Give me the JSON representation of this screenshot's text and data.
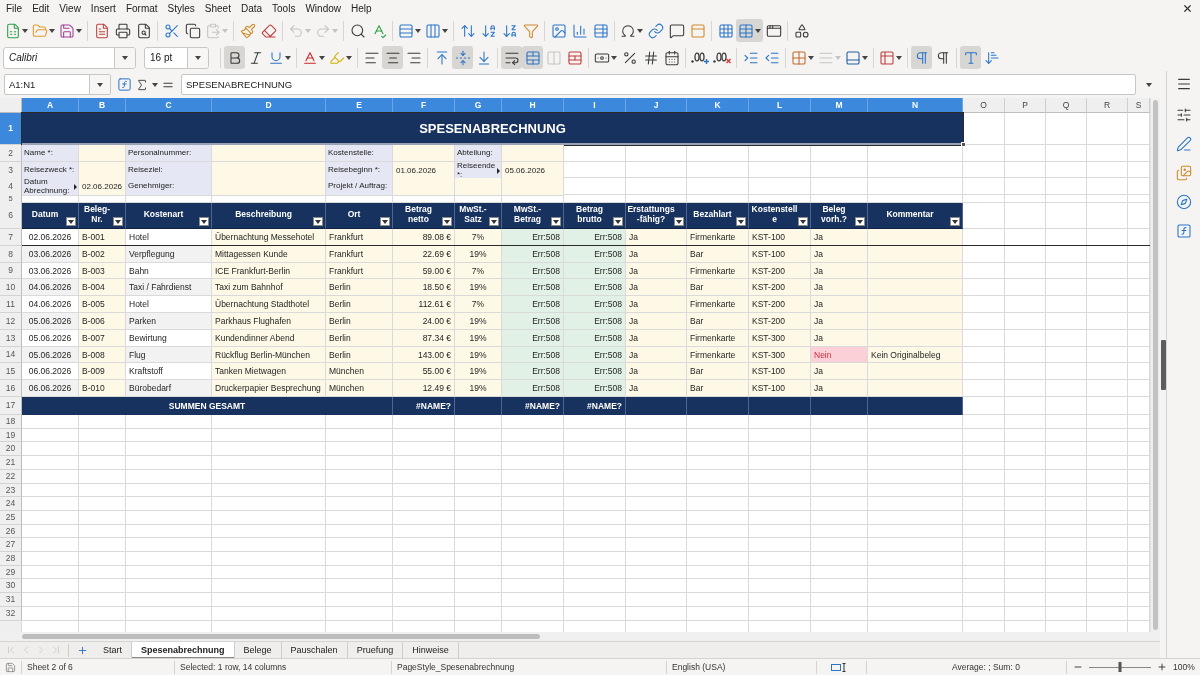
{
  "menu": [
    "File",
    "Edit",
    "View",
    "Insert",
    "Format",
    "Styles",
    "Sheet",
    "Data",
    "Tools",
    "Window",
    "Help"
  ],
  "toolbars": [
    {
      "items": [
        {
          "kind": "button",
          "active": false,
          "disabled": false,
          "dropdown": true
        },
        {
          "kind": "button",
          "active": false,
          "disabled": false,
          "dropdown": true
        },
        {
          "kind": "button",
          "active": false,
          "disabled": false,
          "dropdown": true
        },
        {
          "kind": "separator"
        },
        {
          "kind": "button",
          "active": false,
          "disabled": false,
          "dropdown": false
        },
        {
          "kind": "button",
          "active": false,
          "disabled": false,
          "dropdown": false
        },
        {
          "kind": "button",
          "active": false,
          "disabled": false,
          "dropdown": false
        },
        {
          "kind": "separator"
        },
        {
          "kind": "button",
          "active": false,
          "disabled": false,
          "dropdown": false
        },
        {
          "kind": "button",
          "active": false,
          "disabled": false,
          "dropdown": false
        },
        {
          "kind": "button",
          "active": false,
          "disabled": true,
          "dropdown": true
        },
        {
          "kind": "separator"
        },
        {
          "kind": "button",
          "active": false,
          "disabled": false,
          "dropdown": false
        },
        {
          "kind": "button",
          "active": false,
          "disabled": false,
          "dropdown": false
        },
        {
          "kind": "separator"
        },
        {
          "kind": "button",
          "active": false,
          "disabled": true,
          "dropdown": true
        },
        {
          "kind": "button",
          "active": false,
          "disabled": true,
          "dropdown": true
        },
        {
          "kind": "separator"
        },
        {
          "kind": "button",
          "active": false,
          "disabled": false,
          "dropdown": false
        },
        {
          "kind": "button",
          "active": false,
          "disabled": false,
          "dropdown": false
        },
        {
          "kind": "separator"
        },
        {
          "kind": "button",
          "active": false,
          "disabled": false,
          "dropdown": true
        },
        {
          "kind": "button",
          "active": false,
          "disabled": false,
          "dropdown": true
        },
        {
          "kind": "separator"
        },
        {
          "kind": "button",
          "active": false,
          "disabled": false,
          "dropdown": false
        },
        {
          "kind": "button",
          "active": false,
          "disabled": false,
          "dropdown": false
        },
        {
          "kind": "button",
          "active": false,
          "disabled": false,
          "dropdown": false
        },
        {
          "kind": "button",
          "active": false,
          "disabled": false,
          "dropdown": false
        },
        {
          "kind": "separator"
        },
        {
          "kind": "button",
          "active": false,
          "disabled": false,
          "dropdown": false
        },
        {
          "kind": "button",
          "active": false,
          "disabled": false,
          "dropdown": false
        },
        {
          "kind": "button",
          "active": false,
          "disabled": false,
          "dropdown": false
        },
        {
          "kind": "separator"
        },
        {
          "kind": "button",
          "active": false,
          "disabled": false,
          "dropdown": true
        },
        {
          "kind": "button",
          "active": false,
          "disabled": false,
          "dropdown": false
        },
        {
          "kind": "button",
          "active": false,
          "disabled": false,
          "dropdown": false
        },
        {
          "kind": "button",
          "active": false,
          "disabled": false,
          "dropdown": false
        },
        {
          "kind": "separator"
        },
        {
          "kind": "button",
          "active": false,
          "disabled": false,
          "dropdown": false
        },
        {
          "kind": "button",
          "active": true,
          "disabled": false,
          "dropdown": true
        },
        {
          "kind": "button",
          "active": false,
          "disabled": false,
          "dropdown": false
        },
        {
          "kind": "separator"
        },
        {
          "kind": "button",
          "active": false,
          "disabled": false,
          "dropdown": false
        }
      ]
    },
    {
      "items": [
        {
          "kind": "combo",
          "value": "Calibri"
        },
        {
          "kind": "combo",
          "value": "16 pt"
        },
        {
          "kind": "separator"
        },
        {
          "kind": "button",
          "active": true,
          "disabled": false,
          "dropdown": false
        },
        {
          "kind": "button",
          "active": false,
          "disabled": false,
          "dropdown": false
        },
        {
          "kind": "button",
          "active": false,
          "disabled": false,
          "dropdown": true
        },
        {
          "kind": "separator"
        },
        {
          "kind": "button",
          "active": false,
          "disabled": false,
          "dropdown": true
        },
        {
          "kind": "button",
          "active": false,
          "disabled": false,
          "dropdown": true
        },
        {
          "kind": "separator"
        },
        {
          "kind": "button",
          "active": false,
          "disabled": false,
          "dropdown": false
        },
        {
          "kind": "button",
          "active": true,
          "disabled": false,
          "dropdown": false
        },
        {
          "kind": "button",
          "active": false,
          "disabled": false,
          "dropdown": false
        },
        {
          "kind": "separator"
        },
        {
          "kind": "button",
          "active": false,
          "disabled": false,
          "dropdown": false
        },
        {
          "kind": "button",
          "active": true,
          "disabled": false,
          "dropdown": false
        },
        {
          "kind": "button",
          "active": false,
          "disabled": false,
          "dropdown": false
        },
        {
          "kind": "separator"
        },
        {
          "kind": "button",
          "active": true,
          "disabled": false,
          "dropdown": false
        },
        {
          "kind": "button",
          "active": true,
          "disabled": false,
          "dropdown": false
        },
        {
          "kind": "button",
          "active": false,
          "disabled": true,
          "dropdown": false
        },
        {
          "kind": "button",
          "active": false,
          "disabled": false,
          "dropdown": false
        },
        {
          "kind": "separator"
        },
        {
          "kind": "button",
          "active": false,
          "disabled": false,
          "dropdown": true
        },
        {
          "kind": "button",
          "active": false,
          "disabled": false,
          "dropdown": false
        },
        {
          "kind": "button",
          "active": false,
          "disabled": false,
          "dropdown": false
        },
        {
          "kind": "button",
          "active": false,
          "disabled": false,
          "dropdown": false
        },
        {
          "kind": "separator"
        },
        {
          "kind": "button",
          "active": false,
          "disabled": false,
          "dropdown": false
        },
        {
          "kind": "button",
          "active": false,
          "disabled": false,
          "dropdown": false
        },
        {
          "kind": "separator"
        },
        {
          "kind": "button",
          "active": false,
          "disabled": false,
          "dropdown": false
        },
        {
          "kind": "button",
          "active": false,
          "disabled": false,
          "dropdown": false
        },
        {
          "kind": "separator"
        },
        {
          "kind": "button",
          "active": false,
          "disabled": false,
          "dropdown": true
        },
        {
          "kind": "button",
          "active": false,
          "disabled": true,
          "dropdown": true
        },
        {
          "kind": "button",
          "active": false,
          "disabled": false,
          "dropdown": true
        },
        {
          "kind": "separator"
        },
        {
          "kind": "button",
          "active": false,
          "disabled": false,
          "dropdown": true
        },
        {
          "kind": "separator"
        },
        {
          "kind": "button",
          "active": true,
          "disabled": false,
          "dropdown": false
        },
        {
          "kind": "button",
          "active": false,
          "disabled": false,
          "dropdown": false
        },
        {
          "kind": "separator"
        },
        {
          "kind": "button",
          "active": true,
          "disabled": false,
          "dropdown": false
        },
        {
          "kind": "button",
          "active": false,
          "disabled": false,
          "dropdown": false
        }
      ]
    }
  ],
  "formula_bar": {
    "name_box": "A1:N1",
    "value": "SPESENABRECHNUNG"
  },
  "sheet": {
    "columns": [
      {
        "label": "A",
        "selected": true
      },
      {
        "label": "B",
        "selected": true
      },
      {
        "label": "C",
        "selected": true
      },
      {
        "label": "D",
        "selected": true
      },
      {
        "label": "E",
        "selected": true
      },
      {
        "label": "F",
        "selected": true
      },
      {
        "label": "G",
        "selected": true
      },
      {
        "label": "H",
        "selected": true
      },
      {
        "label": "I",
        "selected": true
      },
      {
        "label": "J",
        "selected": true
      },
      {
        "label": "K",
        "selected": true
      },
      {
        "label": "L",
        "selected": true
      },
      {
        "label": "M",
        "selected": true
      },
      {
        "label": "N",
        "selected": true
      },
      {
        "label": "O",
        "selected": false
      },
      {
        "label": "P",
        "selected": false
      },
      {
        "label": "Q",
        "selected": false
      },
      {
        "label": "R",
        "selected": false
      },
      {
        "label": "S",
        "selected": false
      }
    ],
    "rows": [
      {
        "label": "1",
        "selected": true
      },
      {
        "label": "2",
        "selected": false
      },
      {
        "label": "3",
        "selected": false
      },
      {
        "label": "4",
        "selected": false
      },
      {
        "label": "5",
        "selected": false
      },
      {
        "label": "6",
        "selected": false
      },
      {
        "label": "7",
        "selected": false
      },
      {
        "label": "8",
        "selected": false
      },
      {
        "label": "9",
        "selected": false
      },
      {
        "label": "10",
        "selected": false
      },
      {
        "label": "11",
        "selected": false
      },
      {
        "label": "12",
        "selected": false
      },
      {
        "label": "13",
        "selected": false
      },
      {
        "label": "14",
        "selected": false
      },
      {
        "label": "15",
        "selected": false
      },
      {
        "label": "16",
        "selected": false
      },
      {
        "label": "17",
        "selected": false
      },
      {
        "label": "18",
        "selected": false
      },
      {
        "label": "19",
        "selected": false
      },
      {
        "label": "20",
        "selected": false
      },
      {
        "label": "21",
        "selected": false
      },
      {
        "label": "22",
        "selected": false
      },
      {
        "label": "23",
        "selected": false
      },
      {
        "label": "24",
        "selected": false
      },
      {
        "label": "25",
        "selected": false
      },
      {
        "label": "26",
        "selected": false
      },
      {
        "label": "27",
        "selected": false
      },
      {
        "label": "28",
        "selected": false
      },
      {
        "label": "29",
        "selected": false
      },
      {
        "label": "30",
        "selected": false
      },
      {
        "label": "31",
        "selected": false
      },
      {
        "label": "32",
        "selected": false
      }
    ],
    "title": {
      "text": "SPESENABRECHNUNG",
      "selected": true
    },
    "form": [
      {
        "cells": [
          {
            "kind": "label",
            "text": "Name *:",
            "clipped": false
          },
          {
            "kind": "field"
          },
          {
            "kind": "label",
            "text": "Personalnummer:",
            "clipped": false
          },
          {
            "kind": "field"
          },
          {
            "kind": "label",
            "text": "Kostenstelle:",
            "clipped": false
          },
          {
            "kind": "field"
          },
          {
            "kind": "label",
            "text": "Abteilung:",
            "clipped": false
          },
          {
            "kind": "field"
          }
        ]
      },
      {
        "cells": [
          {
            "kind": "label",
            "text": "Reisezweck *:",
            "clipped": false
          },
          {
            "kind": "field"
          },
          {
            "kind": "label",
            "text": "Reiseziel:",
            "clipped": false
          },
          {
            "kind": "field"
          },
          {
            "kind": "label",
            "text": "Reisebeginn *:",
            "clipped": false
          },
          {
            "kind": "field",
            "value": "01.06.2026"
          },
          {
            "kind": "label",
            "text": "Reiseende\n*:",
            "clipped": true
          },
          {
            "kind": "field",
            "value": "05.06.2026"
          }
        ]
      },
      {
        "cells": [
          {
            "kind": "label",
            "text": "Datum\nAbrechnung:",
            "clipped": true
          },
          {
            "kind": "field",
            "value": "02.06.2026"
          },
          {
            "kind": "label",
            "text": "Genehmiger:",
            "clipped": false
          },
          {
            "kind": "field"
          },
          {
            "kind": "label",
            "text": "Projekt / Auftrag:",
            "clipped": false
          },
          {
            "kind": "field"
          },
          {
            "kind": "field"
          },
          {
            "kind": "field"
          }
        ]
      }
    ],
    "table": {
      "columns": [
        "Datum",
        "Beleg-\nNr.",
        "Kostenart",
        "Beschreibung",
        "Ort",
        "Betrag\nnetto",
        "MwSt.-\nSatz",
        "MwSt.-\nBetrag",
        "Betrag\nbrutto",
        "Erstattungs\n-fähig?",
        "Bezahlart",
        "Kostenstell\ne",
        "Beleg\nvorh.?",
        "Kommentar"
      ],
      "rows": [
        {
          "cells": [
            "02.06.2026",
            "B-001",
            "Hotel",
            "Übernachtung Messehotel",
            "Frankfurt",
            "89.08 €",
            "7%",
            "Err:508",
            "Err:508",
            "Ja",
            "Firmenkarte",
            "KST-100",
            "Ja"
          ],
          "missing_receipt": false,
          "freeze_below": true
        },
        {
          "cells": [
            "03.06.2026",
            "B-002",
            "Verpflegung",
            "Mittagessen Kunde",
            "Frankfurt",
            "22.69 €",
            "19%",
            "Err:508",
            "Err:508",
            "Ja",
            "Bar",
            "KST-100",
            "Ja"
          ],
          "missing_receipt": false,
          "freeze_below": false
        },
        {
          "cells": [
            "03.06.2026",
            "B-003",
            "Bahn",
            "ICE Frankfurt-Berlin",
            "Frankfurt",
            "59.00 €",
            "7%",
            "Err:508",
            "Err:508",
            "Ja",
            "Firmenkarte",
            "KST-200",
            "Ja"
          ],
          "missing_receipt": false,
          "freeze_below": false
        },
        {
          "cells": [
            "04.06.2026",
            "B-004",
            "Taxi / Fahrdienst",
            "Taxi zum Bahnhof",
            "Berlin",
            "18.50 €",
            "19%",
            "Err:508",
            "Err:508",
            "Ja",
            "Bar",
            "KST-200",
            "Ja"
          ],
          "missing_receipt": false,
          "freeze_below": false
        },
        {
          "cells": [
            "04.06.2026",
            "B-005",
            "Hotel",
            "Übernachtung Stadthotel",
            "Berlin",
            "112.61 €",
            "7%",
            "Err:508",
            "Err:508",
            "Ja",
            "Firmenkarte",
            "KST-200",
            "Ja"
          ],
          "missing_receipt": false,
          "freeze_below": false
        },
        {
          "cells": [
            "05.06.2026",
            "B-006",
            "Parken",
            "Parkhaus Flughafen",
            "Berlin",
            "24.00 €",
            "19%",
            "Err:508",
            "Err:508",
            "Ja",
            "Bar",
            "KST-200",
            "Ja"
          ],
          "missing_receipt": false,
          "freeze_below": false
        },
        {
          "cells": [
            "05.06.2026",
            "B-007",
            "Bewirtung",
            "Kundendinner Abend",
            "Berlin",
            "87.34 €",
            "19%",
            "Err:508",
            "Err:508",
            "Ja",
            "Firmenkarte",
            "KST-300",
            "Ja"
          ],
          "missing_receipt": false,
          "freeze_below": false
        },
        {
          "cells": [
            "05.06.2026",
            "B-008",
            "Flug",
            "Rückflug Berlin-München",
            "Berlin",
            "143.00 €",
            "19%",
            "Err:508",
            "Err:508",
            "Ja",
            "Firmenkarte",
            "KST-300",
            "Nein",
            "Kein Originalbeleg"
          ],
          "missing_receipt": true,
          "freeze_below": false
        },
        {
          "cells": [
            "06.06.2026",
            "B-009",
            "Kraftstoff",
            "Tanken Mietwagen",
            "München",
            "55.00 €",
            "19%",
            "Err:508",
            "Err:508",
            "Ja",
            "Bar",
            "KST-100",
            "Ja"
          ],
          "missing_receipt": false,
          "freeze_below": false
        },
        {
          "cells": [
            "06.06.2026",
            "B-010",
            "Bürobedarf",
            "Druckerpapier Besprechung",
            "München",
            "12.49 €",
            "19%",
            "Err:508",
            "Err:508",
            "Ja",
            "Bar",
            "KST-100",
            "Ja"
          ],
          "missing_receipt": false,
          "freeze_below": false
        }
      ]
    },
    "totals": {
      "label": "SUMMEN GESAMT",
      "betrag_netto": "#NAME?",
      "mwst_betrag": "#NAME?",
      "betrag_brutto": "#NAME?"
    }
  },
  "sheet_tabs": {
    "nav_disabled": true,
    "tabs": [
      {
        "label": "Start",
        "selected": false
      },
      {
        "label": "Spesenabrechnung",
        "selected": true
      },
      {
        "label": "Belege",
        "selected": false
      },
      {
        "label": "Pauschalen",
        "selected": false
      },
      {
        "label": "Pruefung",
        "selected": false
      },
      {
        "label": "Hinweise",
        "selected": false
      }
    ]
  },
  "status_bar": {
    "sheet": "Sheet 2 of 6",
    "selection": "Selected: 1 row, 14 columns",
    "page_style": "PageStyle_Spesenabrechnung",
    "language": "English (USA)",
    "summary": "Average: ; Sum: 0",
    "zoom": {
      "level": 0.5,
      "text": "100%"
    }
  }
}
